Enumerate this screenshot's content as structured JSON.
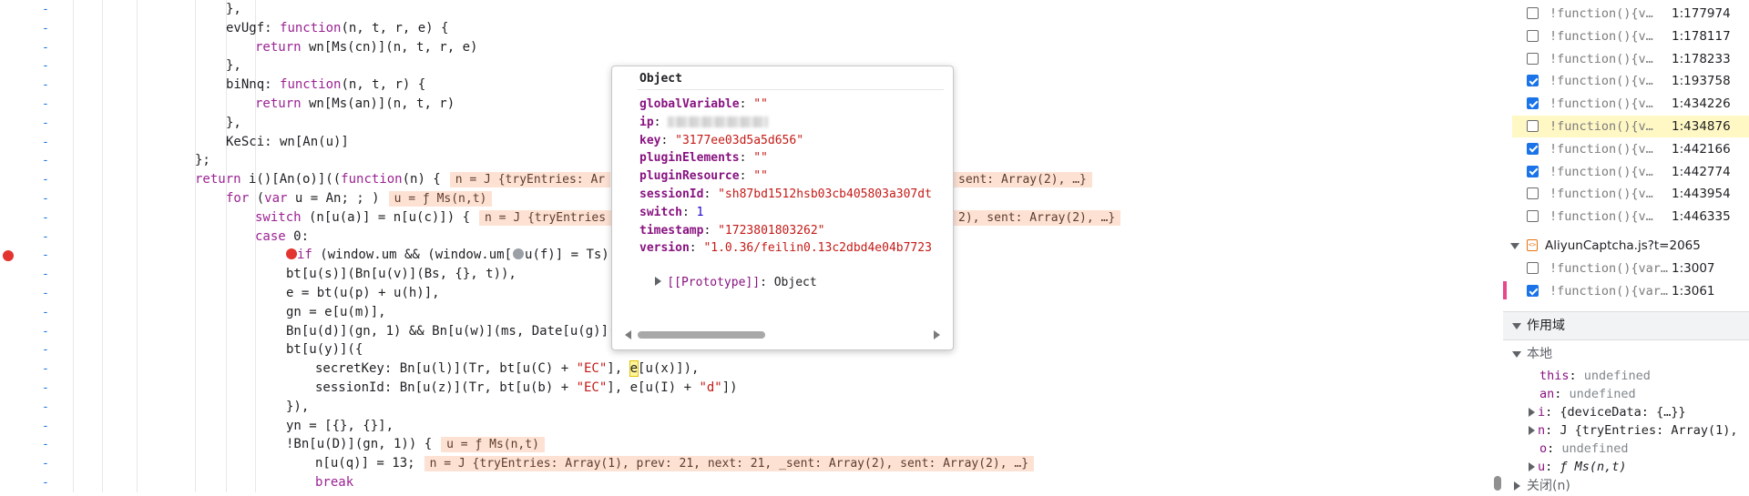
{
  "editor": {
    "gutter_marker": "-",
    "lines": [
      {
        "segs": [
          {
            "t": "},",
            "c": ""
          }
        ]
      },
      {
        "segs": [
          {
            "t": "evUgf: ",
            "c": ""
          },
          {
            "t": "function",
            "c": "kw"
          },
          {
            "t": "(n, t, r, e) {",
            "c": ""
          }
        ]
      },
      {
        "segs": [
          {
            "t": "return",
            "c": "kw"
          },
          {
            "t": " wn[Ms(cn)](n, t, r, e)",
            "c": ""
          }
        ]
      },
      {
        "segs": [
          {
            "t": "},",
            "c": ""
          }
        ]
      },
      {
        "segs": [
          {
            "t": "biNnq: ",
            "c": ""
          },
          {
            "t": "function",
            "c": "kw"
          },
          {
            "t": "(n, t, r) {",
            "c": ""
          }
        ]
      },
      {
        "segs": [
          {
            "t": "return",
            "c": "kw"
          },
          {
            "t": " wn[Ms(an)](n, t, r)",
            "c": ""
          }
        ]
      },
      {
        "segs": [
          {
            "t": "},",
            "c": ""
          }
        ]
      },
      {
        "segs": [
          {
            "t": "KeSci: wn[An(u)]",
            "c": ""
          }
        ]
      },
      {
        "segs": [
          {
            "t": "};",
            "c": ""
          }
        ]
      },
      {
        "segs": [
          {
            "t": "return",
            "c": "kw"
          },
          {
            "t": " i()[An(o)]((",
            "c": ""
          },
          {
            "t": "function",
            "c": "kw"
          },
          {
            "t": "(n) {",
            "c": ""
          }
        ]
      },
      {
        "segs": [
          {
            "t": "for",
            "c": "kw"
          },
          {
            "t": " (",
            "c": ""
          },
          {
            "t": "var",
            "c": "kw"
          },
          {
            "t": " u = An; ; )",
            "c": ""
          }
        ]
      },
      {
        "segs": [
          {
            "t": "switch",
            "c": "kw"
          },
          {
            "t": " (n[u(a)] = n[u(c)]) {",
            "c": ""
          }
        ]
      },
      {
        "segs": [
          {
            "t": "case",
            "c": "kw"
          },
          {
            "t": " 0:",
            "c": ""
          }
        ]
      },
      {
        "segs": [
          {
            "t": "if",
            "c": "kw"
          },
          {
            "t": " (window.um && (window.um[",
            "c": ""
          },
          {
            "t": "u(f)] = Ts),",
            "c": ""
          }
        ]
      },
      {
        "segs": [
          {
            "t": "bt[u(s)](Bn[u(v)](Bs, {}, t)),",
            "c": ""
          }
        ]
      },
      {
        "segs": [
          {
            "t": "e = bt(u(p) + u(h)],",
            "c": ""
          }
        ]
      },
      {
        "segs": [
          {
            "t": "gn = e[u(m)],",
            "c": ""
          }
        ]
      },
      {
        "segs": [
          {
            "t": "Bn[u(d)](gn, 1) && Bn[u(w)](ms, Date[u(g)]()",
            "c": ""
          }
        ]
      },
      {
        "segs": [
          {
            "t": "bt[u(y)]({",
            "c": ""
          }
        ]
      },
      {
        "segs": [
          {
            "t": "secretKey: Bn[u(l)](Tr, bt[u(C) + ",
            "c": ""
          },
          {
            "t": "\"EC\"",
            "c": "str"
          },
          {
            "t": "], ",
            "c": ""
          },
          {
            "t": "e",
            "c": "hl"
          },
          {
            "t": "[u(x)]),",
            "c": ""
          }
        ]
      },
      {
        "segs": [
          {
            "t": "sessionId: Bn[u(z)](Tr, bt[u(b) + ",
            "c": ""
          },
          {
            "t": "\"EC\"",
            "c": "str"
          },
          {
            "t": "], e[u(I) + ",
            "c": ""
          },
          {
            "t": "\"d\"",
            "c": "str"
          },
          {
            "t": "])",
            "c": ""
          }
        ]
      },
      {
        "segs": [
          {
            "t": "}),",
            "c": ""
          }
        ]
      },
      {
        "segs": [
          {
            "t": "yn = [{}, {}],",
            "c": ""
          }
        ]
      },
      {
        "segs": [
          {
            "t": "!Bn[u(D)](gn, 1)) {",
            "c": ""
          }
        ]
      },
      {
        "segs": [
          {
            "t": "n[u(q)] = 13;",
            "c": ""
          }
        ]
      },
      {
        "segs": [
          {
            "t": "break",
            "c": "kw"
          }
        ]
      }
    ],
    "inline_values": {
      "line9_left": "n = J {tryEntries: Ar",
      "line9_right": "sent: Array(2), …}",
      "line10": "u = ƒ Ms(n,t)",
      "line11_left": "n = J {tryEntries",
      "line11_right": "2), sent: Array(2), …}",
      "line23": "u = ƒ Ms(n,t)",
      "line24": "n = J {tryEntries: Array(1), prev: 21, next: 21, _sent: Array(2), sent: Array(2), …}"
    }
  },
  "popover": {
    "title": "Object",
    "props": [
      {
        "key": "globalVariable",
        "val": "\"\"",
        "type": "str"
      },
      {
        "key": "ip",
        "val": "",
        "type": "blur"
      },
      {
        "key": "key",
        "val": "\"3177ee03d5a5d656\"",
        "type": "str"
      },
      {
        "key": "pluginElements",
        "val": "\"\"",
        "type": "str"
      },
      {
        "key": "pluginResource",
        "val": "\"\"",
        "type": "str"
      },
      {
        "key": "sessionId",
        "val": "\"sh87bd1512hsb03cb405803a307dt",
        "type": "str"
      },
      {
        "key": "switch",
        "val": "1",
        "type": "num"
      },
      {
        "key": "timestamp",
        "val": "\"1723801803262\"",
        "type": "str"
      },
      {
        "key": "version",
        "val": "\"1.0.36/feilin0.13c2dbd4e04b7723",
        "type": "str"
      }
    ],
    "proto_key": "[[Prototype]]",
    "proto_val": ": Object"
  },
  "panel": {
    "breakpoints": [
      {
        "code": "!function(){v…",
        "loc": "1:177974",
        "checked": false,
        "active": false
      },
      {
        "code": "!function(){v…",
        "loc": "1:178117",
        "checked": false,
        "active": false
      },
      {
        "code": "!function(){v…",
        "loc": "1:178233",
        "checked": false,
        "active": false
      },
      {
        "code": "!function(){v…",
        "loc": "1:193758",
        "checked": true,
        "active": false
      },
      {
        "code": "!function(){v…",
        "loc": "1:434226",
        "checked": true,
        "active": false
      },
      {
        "code": "!function(){v…",
        "loc": "1:434876",
        "checked": false,
        "active": true
      },
      {
        "code": "!function(){v…",
        "loc": "1:442166",
        "checked": true,
        "active": false
      },
      {
        "code": "!function(){v…",
        "loc": "1:442774",
        "checked": true,
        "active": false
      },
      {
        "code": "!function(){v…",
        "loc": "1:443954",
        "checked": false,
        "active": false
      },
      {
        "code": "!function(){v…",
        "loc": "1:446335",
        "checked": false,
        "active": false
      }
    ],
    "file": {
      "name": "AliyunCaptcha.js?t=2065"
    },
    "file_breakpoints": [
      {
        "code": "!function(){var…",
        "loc": "1:3007",
        "checked": false
      },
      {
        "code": "!function(){var…",
        "loc": "1:3061",
        "checked": true
      }
    ],
    "scope_section": "作用域",
    "local_header": "本地",
    "scope_vars": [
      {
        "key": "this",
        "val": "undefined",
        "kind": "undef",
        "expandable": false
      },
      {
        "key": "an",
        "val": "undefined",
        "kind": "undef",
        "expandable": false
      },
      {
        "key": "i",
        "val": "{deviceData: {…}}",
        "kind": "val",
        "expandable": true
      },
      {
        "key": "n",
        "val": "J {tryEntries: Array(1),",
        "kind": "val",
        "expandable": true
      },
      {
        "key": "o",
        "val": "undefined",
        "kind": "undef",
        "expandable": false
      },
      {
        "key": "u",
        "val": "ƒ Ms(n,t)",
        "kind": "fn",
        "expandable": true
      }
    ],
    "closure_label": "关闭(n)"
  }
}
